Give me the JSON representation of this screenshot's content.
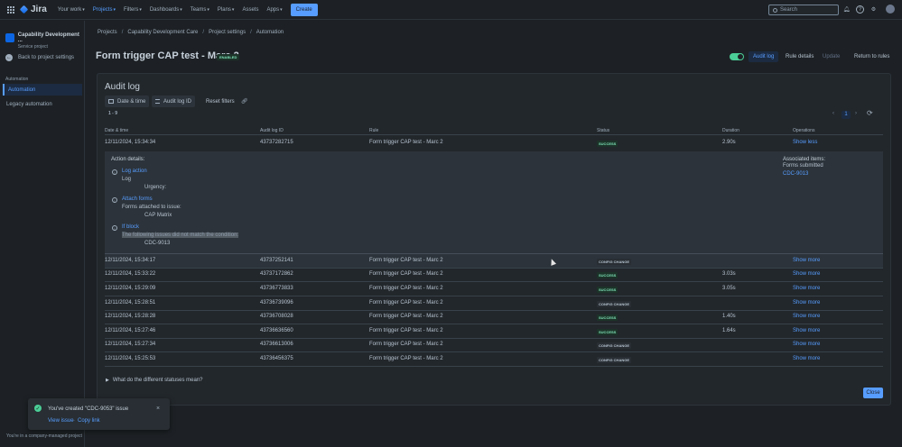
{
  "nav": {
    "logo": "Jira",
    "items": [
      "Your work",
      "Projects",
      "Filters",
      "Dashboards",
      "Teams",
      "Plans",
      "Assets",
      "Apps"
    ],
    "create": "Create",
    "search_placeholder": "Search"
  },
  "sidebar": {
    "project_name": "Capability Development ...",
    "project_type": "Service project",
    "back": "Back to project settings",
    "section": "Automation",
    "items": [
      "Automation",
      "Legacy automation"
    ]
  },
  "breadcrumbs": [
    "Projects",
    "Capability Development Care",
    "Project settings",
    "Automation"
  ],
  "header": {
    "title": "Form trigger CAP test - Marc 2",
    "badge": "ENABLED",
    "audit_log": "Audit log",
    "rule_details": "Rule details",
    "update": "Update",
    "return": "Return to rules"
  },
  "audit": {
    "title": "Audit log",
    "filter_date": "Date & time",
    "filter_id": "Audit log ID",
    "reset": "Reset filters",
    "range": "1 - 9",
    "page": "1",
    "columns": [
      "Date & time",
      "Audit log ID",
      "Rule",
      "Status",
      "Duration",
      "Operations"
    ],
    "rows": [
      {
        "date": "12/11/2024, 15:34:34",
        "id": "43737282715",
        "rule": "Form trigger CAP test - Marc 2",
        "status": "SUCCESS",
        "duration": "2.90s",
        "op": "Show less"
      },
      {
        "date": "12/11/2024, 15:34:17",
        "id": "43737252141",
        "rule": "Form trigger CAP test - Marc 2",
        "status": "CONFIG CHANGE",
        "duration": "",
        "op": "Show more"
      },
      {
        "date": "12/11/2024, 15:33:22",
        "id": "43737172862",
        "rule": "Form trigger CAP test - Marc 2",
        "status": "SUCCESS",
        "duration": "3.03s",
        "op": "Show more"
      },
      {
        "date": "12/11/2024, 15:29:09",
        "id": "43736773833",
        "rule": "Form trigger CAP test - Marc 2",
        "status": "SUCCESS",
        "duration": "3.05s",
        "op": "Show more"
      },
      {
        "date": "12/11/2024, 15:28:51",
        "id": "43736739096",
        "rule": "Form trigger CAP test - Marc 2",
        "status": "CONFIG CHANGE",
        "duration": "",
        "op": "Show more"
      },
      {
        "date": "12/11/2024, 15:28:28",
        "id": "43736708028",
        "rule": "Form trigger CAP test - Marc 2",
        "status": "SUCCESS",
        "duration": "1.40s",
        "op": "Show more"
      },
      {
        "date": "12/11/2024, 15:27:46",
        "id": "43736636560",
        "rule": "Form trigger CAP test - Marc 2",
        "status": "SUCCESS",
        "duration": "1.64s",
        "op": "Show more"
      },
      {
        "date": "12/11/2024, 15:27:34",
        "id": "43736613006",
        "rule": "Form trigger CAP test - Marc 2",
        "status": "CONFIG CHANGE",
        "duration": "",
        "op": "Show more"
      },
      {
        "date": "12/11/2024, 15:25:53",
        "id": "43736456375",
        "rule": "Form trigger CAP test - Marc 2",
        "status": "CONFIG CHANGE",
        "duration": "",
        "op": "Show more"
      }
    ],
    "details": {
      "heading": "Action details:",
      "a1_title": "Log action",
      "a1_sub": "Log",
      "a1_val": "Urgency:",
      "a2_title": "Attach forms",
      "a2_sub": "Forms attached to issue:",
      "a2_val": "CAP Matrix",
      "a3_title": "If block",
      "a3_sub": "The following issues did not match the condition:",
      "a3_val": "CDC-9013",
      "assoc_title": "Associated items:",
      "assoc_sub": "Forms submitted",
      "assoc_link": "CDC-9013"
    },
    "faq": "What do the different statuses mean?",
    "close": "Close"
  },
  "flag": {
    "message": "You've created \"CDC-9053\" issue",
    "view": "View issue",
    "dot": "·",
    "copy": "Copy link"
  },
  "footer": "You're in a company-managed project",
  "colors": {
    "accent": "#579dff",
    "success": "#4bce97",
    "bg": "#1d2125"
  }
}
